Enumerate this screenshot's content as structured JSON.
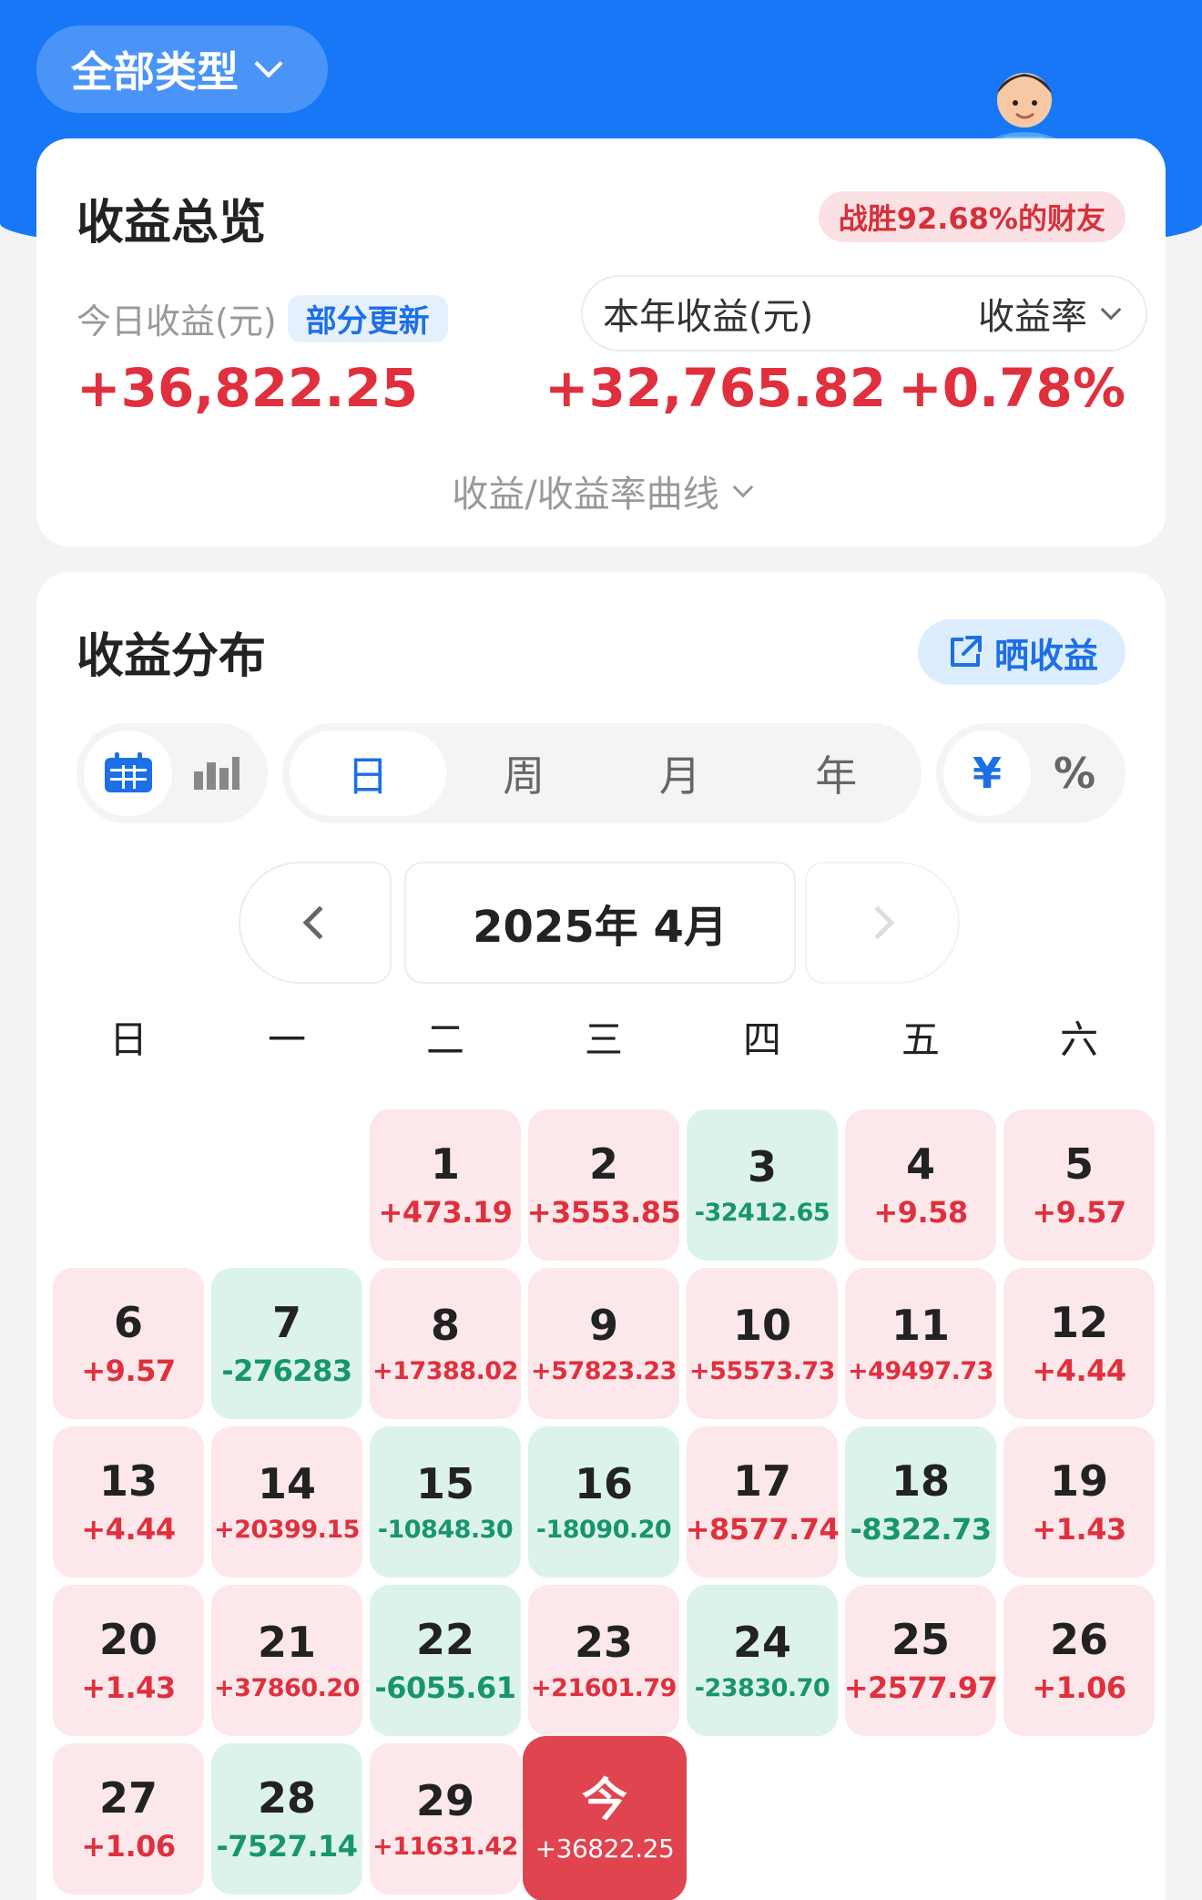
{
  "header": {
    "type_selector": "全部类型"
  },
  "overview": {
    "title": "收益总览",
    "beat_badge": "战胜92.68%的财友",
    "today_label": "今日收益(元)",
    "partial_update": "部分更新",
    "year_label": "本年收益(元)",
    "rate_label": "收益率",
    "today_value": "+36,822.25",
    "year_value": "+32,765.82",
    "rate_value": "+0.78%",
    "curve_toggle": "收益/收益率曲线"
  },
  "distribution": {
    "title": "收益分布",
    "share_button": "晒收益",
    "periods": [
      "日",
      "周",
      "月",
      "年"
    ],
    "active_period": 0,
    "units": [
      "¥",
      "%"
    ],
    "month_label": "2025年 4月",
    "weekdays": [
      "日",
      "一",
      "二",
      "三",
      "四",
      "五",
      "六"
    ],
    "first_weekday": 2,
    "days": [
      {
        "d": "1",
        "v": "+473.19",
        "t": "pos"
      },
      {
        "d": "2",
        "v": "+3553.85",
        "t": "pos"
      },
      {
        "d": "3",
        "v": "-32412.65",
        "t": "neg"
      },
      {
        "d": "4",
        "v": "+9.58",
        "t": "pos"
      },
      {
        "d": "5",
        "v": "+9.57",
        "t": "pos"
      },
      {
        "d": "6",
        "v": "+9.57",
        "t": "pos"
      },
      {
        "d": "7",
        "v": "-276283",
        "t": "neg"
      },
      {
        "d": "8",
        "v": "+17388.02",
        "t": "pos"
      },
      {
        "d": "9",
        "v": "+57823.23",
        "t": "pos"
      },
      {
        "d": "10",
        "v": "+55573.73",
        "t": "pos"
      },
      {
        "d": "11",
        "v": "+49497.73",
        "t": "pos"
      },
      {
        "d": "12",
        "v": "+4.44",
        "t": "pos"
      },
      {
        "d": "13",
        "v": "+4.44",
        "t": "pos"
      },
      {
        "d": "14",
        "v": "+20399.15",
        "t": "pos"
      },
      {
        "d": "15",
        "v": "-10848.30",
        "t": "neg"
      },
      {
        "d": "16",
        "v": "-18090.20",
        "t": "neg"
      },
      {
        "d": "17",
        "v": "+8577.74",
        "t": "pos"
      },
      {
        "d": "18",
        "v": "-8322.73",
        "t": "neg"
      },
      {
        "d": "19",
        "v": "+1.43",
        "t": "pos"
      },
      {
        "d": "20",
        "v": "+1.43",
        "t": "pos"
      },
      {
        "d": "21",
        "v": "+37860.20",
        "t": "pos"
      },
      {
        "d": "22",
        "v": "-6055.61",
        "t": "neg"
      },
      {
        "d": "23",
        "v": "+21601.79",
        "t": "pos"
      },
      {
        "d": "24",
        "v": "-23830.70",
        "t": "neg"
      },
      {
        "d": "25",
        "v": "+2577.97",
        "t": "pos"
      },
      {
        "d": "26",
        "v": "+1.06",
        "t": "pos"
      },
      {
        "d": "27",
        "v": "+1.06",
        "t": "pos"
      },
      {
        "d": "28",
        "v": "-7527.14",
        "t": "neg"
      },
      {
        "d": "29",
        "v": "+11631.42",
        "t": "pos"
      },
      {
        "d": "今",
        "v": "+36822.25",
        "t": "today"
      }
    ]
  },
  "colors": {
    "brand_blue": "#1877f6",
    "gain_red": "#e0303e",
    "loss_green": "#17966a"
  }
}
